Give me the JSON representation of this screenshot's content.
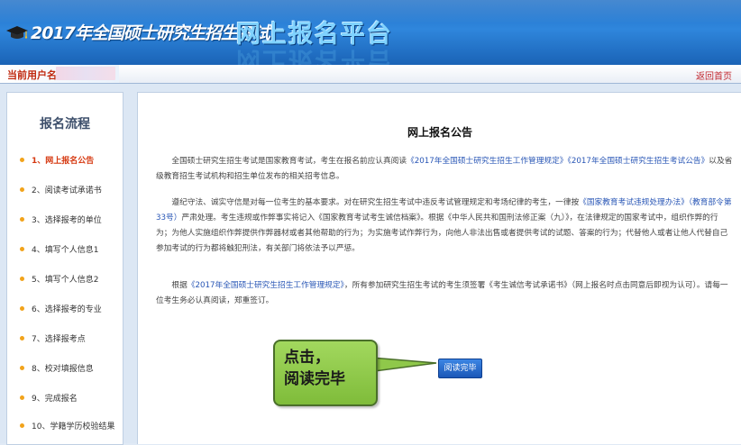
{
  "header": {
    "brand_title": "2017年全国硕士研究生招生考试",
    "platform_title": "网上报名平台"
  },
  "userbar": {
    "user_label": "当前用户名：",
    "home_link": "返回首页"
  },
  "sidebar": {
    "title": "报名流程",
    "steps": [
      "1、网上报名公告",
      "2、阅读考试承诺书",
      "3、选择报考的单位",
      "4、填写个人信息1",
      "5、填写个人信息2",
      "6、选择报考的专业",
      "7、选择报考点",
      "8、校对填报信息",
      "9、完成报名",
      "10、学籍学历校验结果"
    ],
    "active_step": 0
  },
  "notice": {
    "title": "网上报名公告",
    "p1_a": "全国硕士研究生招生考试是国家教育考试，考生在报名前应认真阅读",
    "p1_link1": "《2017年全国硕士研究生招生工作管理规定》",
    "p1_link2": "《2017年全国硕士研究生招生考试公告》",
    "p1_b": "以及省级教育招生考试机构和招生单位发布的相关招考信息。",
    "p2_a": "遵纪守法、诚实守信是对每一位考生的基本要求。对在研究生招生考试中违反考试管理规定和考场纪律的考生，一律按",
    "p2_link1": "《国家教育考试违规处理办法》（教育部令第33号）",
    "p2_b": "严肃处理。考生违规或作弊事实将记入《国家教育考试考生诚信档案》。根据《中华人民共和国刑法修正案（九）》，在法律规定的国家考试中，组织作弊的行为；为他人实施组织作弊提供作弊器材或者其他帮助的行为；为实施考试作弊行为，向他人非法出售或者提供考试的试题、答案的行为；代替他人或者让他人代替自己参加考试的行为都将触犯刑法，有关部门将依法予以严惩。",
    "p3_a": "根据",
    "p3_link1": "《2017年全国硕士研究生招生工作管理规定》",
    "p3_b": "，所有参加研究生招生考试的考生须签署《考生诚信考试承诺书》（网上报名时点击同意后即视为认可）。请每一位考生务必认真阅读，郑重签订。",
    "read_button": "阅读完毕"
  },
  "callout": {
    "text": "点击，\n阅读完毕"
  },
  "colors": {
    "header_blue": "#2f86dc",
    "active_step": "#d63a12",
    "bullet": "#f2a31b",
    "link": "#2a57b6",
    "callout_green": "#8fc84a"
  }
}
